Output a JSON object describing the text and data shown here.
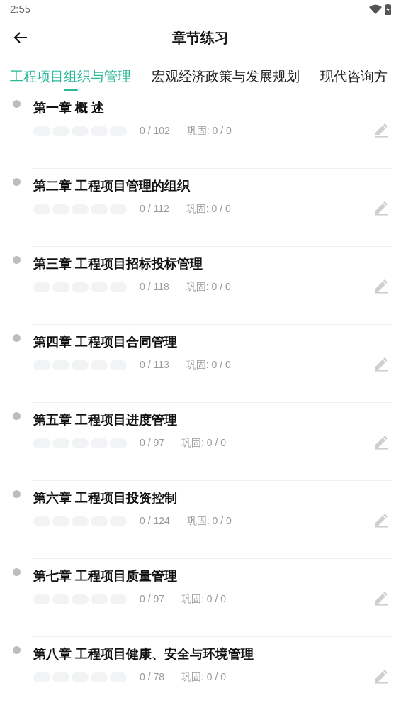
{
  "status_bar": {
    "time": "2:55"
  },
  "header": {
    "title": "章节练习"
  },
  "tabs": [
    {
      "label": "工程项目组织与管理",
      "selected": true
    },
    {
      "label": "宏观经济政策与发展规划",
      "selected": false
    },
    {
      "label": "现代咨询方",
      "selected": false
    }
  ],
  "chapters": [
    {
      "title": "第一章 概 述",
      "progress": "0 / 102",
      "review": "巩固: 0 / 0"
    },
    {
      "title": "第二章 工程项目管理的组织",
      "progress": "0 / 112",
      "review": "巩固: 0 / 0"
    },
    {
      "title": "第三章 工程项目招标投标管理",
      "progress": "0 / 118",
      "review": "巩固: 0 / 0"
    },
    {
      "title": "第四章 工程项目合同管理",
      "progress": "0 / 113",
      "review": "巩固: 0 / 0"
    },
    {
      "title": "第五章 工程项目进度管理",
      "progress": "0 / 97",
      "review": "巩固: 0 / 0"
    },
    {
      "title": "第六章 工程项目投资控制",
      "progress": "0 / 124",
      "review": "巩固: 0 / 0"
    },
    {
      "title": "第七章 工程项目质量管理",
      "progress": "0 / 97",
      "review": "巩固: 0 / 0"
    },
    {
      "title": "第八章 工程项目健康、安全与环境管理",
      "progress": "0 / 78",
      "review": "巩固: 0 / 0"
    }
  ]
}
